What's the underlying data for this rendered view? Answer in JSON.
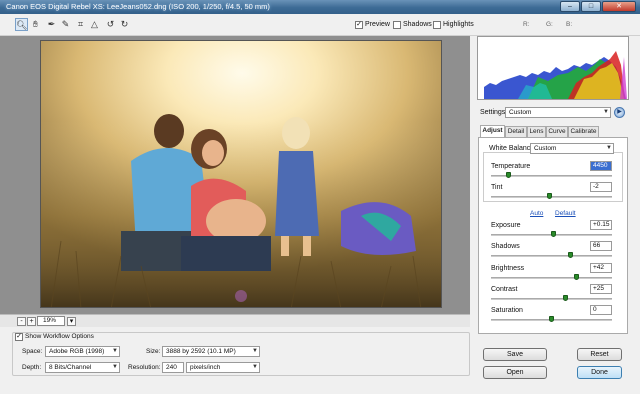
{
  "window": {
    "title": "Canon EOS Digital Rebel XS:  LeeJeans052.dng  (ISO 200, 1/250, f/4.5, 50 mm)",
    "controls": [
      "minimize",
      "maximize",
      "close"
    ]
  },
  "toolbar": {
    "tools": [
      "zoom-icon",
      "hand-icon",
      "white-balance-icon",
      "color-sampler-icon",
      "crop-icon",
      "straighten-icon",
      "rotate-left-icon",
      "rotate-right-icon"
    ],
    "preview_label": "Preview",
    "preview_checked": true,
    "shadows_label": "Shadows",
    "shadows_checked": false,
    "highlights_label": "Highlights",
    "highlights_checked": false,
    "r_label": "R:",
    "g_label": "G:",
    "b_label": "B:"
  },
  "zoom": {
    "minus": "-",
    "plus": "+",
    "value": "19%"
  },
  "workflow": {
    "show_label": "Show Workflow Options",
    "show_checked": true,
    "space_label": "Space:",
    "space_value": "Adobe RGB (1998)",
    "depth_label": "Depth:",
    "depth_value": "8 Bits/Channel",
    "size_label": "Size:",
    "size_value": "3888 by 2592  (10.1 MP)",
    "resolution_label": "Resolution:",
    "resolution_value": "240",
    "resolution_unit": "pixels/inch"
  },
  "settings": {
    "label": "Settings:",
    "value": "Custom"
  },
  "tabs": [
    "Adjust",
    "Detail",
    "Lens",
    "Curve",
    "Calibrate"
  ],
  "active_tab": "Adjust",
  "adjust": {
    "white_balance_label": "White Balance:",
    "white_balance_value": "Custom",
    "temperature_label": "Temperature",
    "temperature_value": "4450",
    "tint_label": "Tint",
    "tint_value": "-2",
    "auto_link": "Auto",
    "default_link": "Default",
    "exposure_label": "Exposure",
    "exposure_value": "+0.15",
    "shadows_label": "Shadows",
    "shadows_value": "66",
    "brightness_label": "Brightness",
    "brightness_value": "+42",
    "contrast_label": "Contrast",
    "contrast_value": "+25",
    "saturation_label": "Saturation",
    "saturation_value": "0"
  },
  "slider_levels": {
    "temperature": 0.15,
    "tint": 0.49,
    "exposure": 0.52,
    "shadows": 0.66,
    "brightness": 0.71,
    "contrast": 0.62,
    "saturation": 0.5
  },
  "buttons": {
    "save": "Save",
    "reset": "Reset",
    "open": "Open",
    "done": "Done"
  },
  "colors": {
    "title_bar": "#3d6b95",
    "link": "#1a4fb8",
    "slider_thumb": "#2a8b2a",
    "selection": "#3a6ed0"
  }
}
